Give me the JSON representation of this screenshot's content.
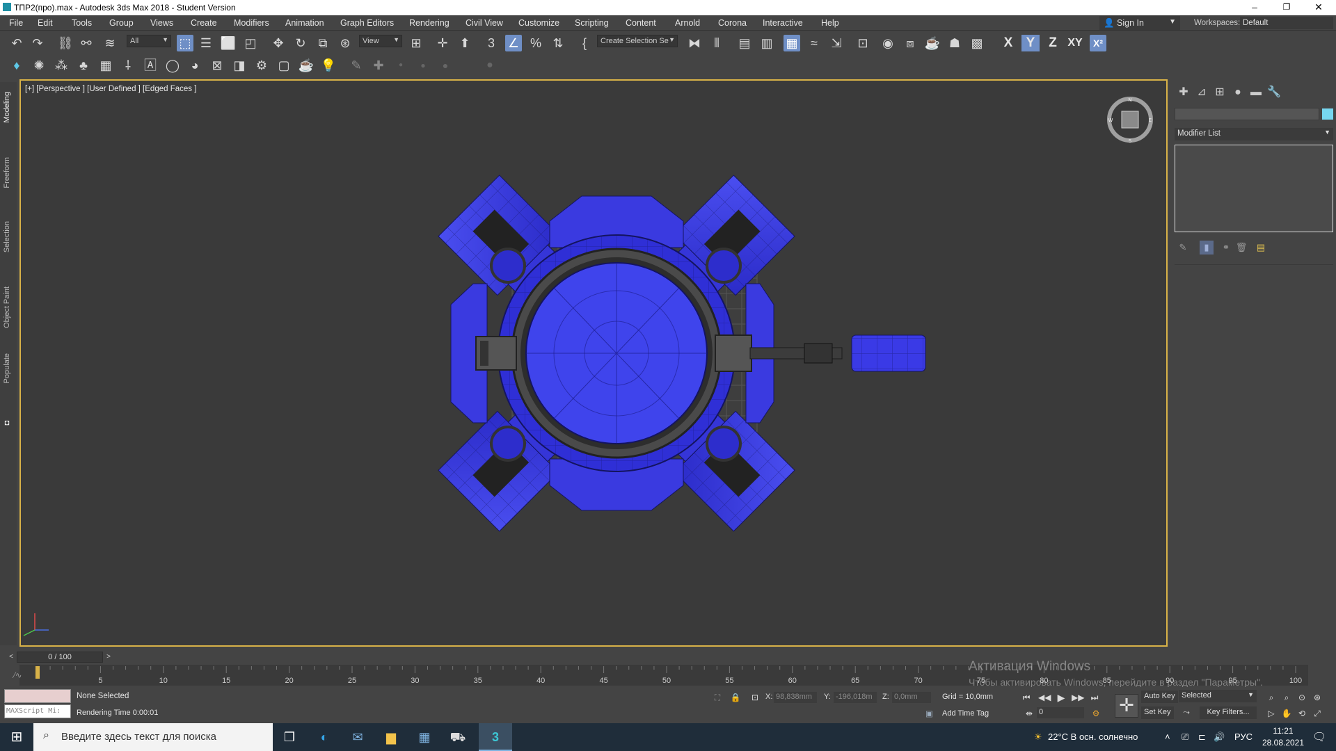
{
  "window": {
    "title": "ТПР2(про).max - Autodesk 3ds Max 2018 - Student Version",
    "controls": [
      "–",
      "❐",
      "✕"
    ]
  },
  "menu": [
    "File",
    "Edit",
    "Tools",
    "Group",
    "Views",
    "Create",
    "Modifiers",
    "Animation",
    "Graph Editors",
    "Rendering",
    "Civil View",
    "Customize",
    "Scripting",
    "Content",
    "Arnold",
    "Corona",
    "Interactive",
    "Help"
  ],
  "account": {
    "signin": "Sign In",
    "workspaces_label": "Workspaces:",
    "workspace": "Default"
  },
  "toolbar": {
    "filter": "All",
    "ref_coord": "View",
    "selection_set": "Create Selection Se",
    "axes": [
      "X",
      "Y",
      "Z",
      "XY"
    ]
  },
  "ribbon_tabs": [
    "Modeling",
    "Freeform",
    "Selection",
    "Object Paint",
    "Populate"
  ],
  "viewport": {
    "label": "[+] [Perspective ] [User Defined ] [Edged Faces ]",
    "viewcube_letters": [
      "N",
      "W",
      "S",
      "E"
    ]
  },
  "command_panel": {
    "modifier_list": "Modifier List"
  },
  "timeline": {
    "frame": "0 / 100",
    "ticks": [
      "5",
      "10",
      "15",
      "20",
      "25",
      "30",
      "35",
      "40",
      "45",
      "50",
      "55",
      "60",
      "65",
      "70",
      "75",
      "80",
      "85",
      "90",
      "95",
      "100"
    ]
  },
  "watermark": {
    "line1": "Активация Windows",
    "line2": "Чтобы активировать Windows, перейдите в раздел \"Параметры\"."
  },
  "status": {
    "maxscript": "MAXScript Mi:",
    "selection": "None Selected",
    "rendering_time": "Rendering Time  0:00:01",
    "x_label": "X:",
    "x_value": "98,838mm",
    "y_label": "Y:",
    "y_value": "-196,018m",
    "z_label": "Z:",
    "z_value": "0,0mm",
    "grid": "Grid = 10,0mm",
    "add_time_tag": "Add Time Tag",
    "auto_key": "Auto Key",
    "set_key": "Set Key",
    "key_mode": "Selected",
    "key_filters": "Key Filters...",
    "frame_value": "0"
  },
  "taskbar": {
    "search_placeholder": "Введите здесь текст для поиска",
    "weather": "22°C  В осн. солнечно",
    "language": "РУС",
    "time": "11:21",
    "date": "28.08.2021"
  },
  "colors": {
    "model_blue": "#2f2fe0",
    "viewport_border": "#d8b248",
    "active_tool": "#6f8fc6"
  }
}
